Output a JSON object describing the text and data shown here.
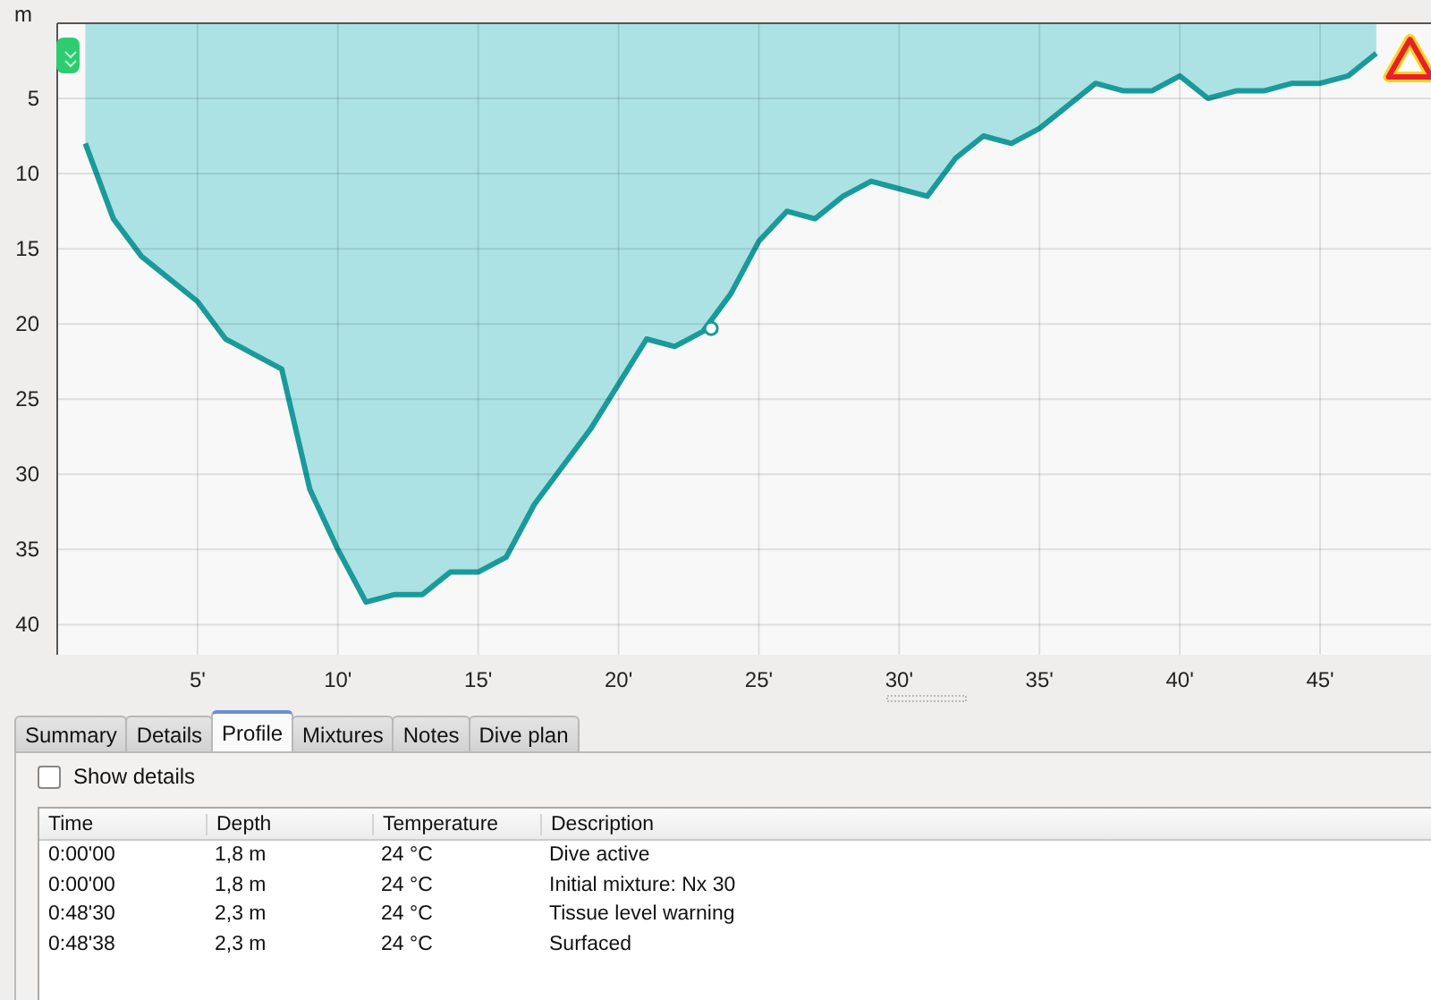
{
  "profile": {
    "chart_data": {
      "type": "area",
      "ylabel": "m",
      "x": [
        1,
        2,
        3,
        4,
        5,
        6,
        7,
        8,
        9,
        10,
        11,
        12,
        13,
        14,
        15,
        16,
        17,
        18,
        19,
        20,
        21,
        22,
        23,
        24,
        25,
        26,
        27,
        28,
        29,
        30,
        31,
        32,
        33,
        34,
        35,
        36,
        37,
        38,
        39,
        40,
        41,
        42,
        43,
        44,
        45,
        46,
        47
      ],
      "series": [
        {
          "color": "#1a9a9a",
          "values": [
            8,
            13,
            15.5,
            17,
            18.5,
            21,
            22,
            23,
            31,
            35,
            38.5,
            38,
            38,
            36.5,
            36.5,
            35.5,
            32,
            29.5,
            27,
            24,
            21,
            21.5,
            20.5,
            18,
            14.5,
            12.5,
            13,
            11.5,
            10.5,
            11,
            11.5,
            9,
            7.5,
            8,
            7,
            5.5,
            4,
            4.5,
            4.5,
            3.5,
            5,
            4.5,
            4.5,
            4,
            4,
            3.5,
            2
          ]
        }
      ],
      "xlim": [
        0,
        48.95
      ],
      "grid": true,
      "ylim": [
        42,
        0
      ],
      "xticks": [
        {
          "value": 5,
          "label": "5'"
        },
        {
          "value": 10,
          "label": "10'"
        },
        {
          "value": 15,
          "label": "15'"
        },
        {
          "value": 20,
          "label": "20'"
        },
        {
          "value": 25,
          "label": "25'"
        },
        {
          "value": 30,
          "label": "30'"
        },
        {
          "value": 35,
          "label": "35'"
        },
        {
          "value": 40,
          "label": "40'"
        },
        {
          "value": 45,
          "label": "45'"
        }
      ],
      "yticks": [
        5,
        10,
        15,
        20,
        25,
        30,
        35,
        40
      ]
    },
    "markers": [
      {
        "kind": "start"
      },
      {
        "kind": "event"
      },
      {
        "kind": "warning"
      }
    ]
  },
  "tabs": [
    {
      "label": "Summary",
      "selected": false
    },
    {
      "label": "Details",
      "selected": false
    },
    {
      "label": "Profile",
      "selected": true
    },
    {
      "label": "Mixtures",
      "selected": false
    },
    {
      "label": "Notes",
      "selected": false
    },
    {
      "label": "Dive plan",
      "selected": false
    }
  ],
  "show_details": {
    "label": "Show details",
    "checked": false
  },
  "table": {
    "columns": [
      "Time",
      "Depth",
      "Temperature",
      "Description"
    ],
    "rows": [
      [
        "0:00'00",
        "1,8 m",
        "24 °C",
        "Dive active"
      ],
      [
        "0:00'00",
        "1,8 m",
        "24 °C",
        "Initial mixture: Nx 30"
      ],
      [
        "0:48'30",
        "2,3 m",
        "24 °C",
        "Tissue level warning"
      ],
      [
        "0:48'38",
        "2,3 m",
        "24 °C",
        "Surfaced"
      ]
    ]
  }
}
